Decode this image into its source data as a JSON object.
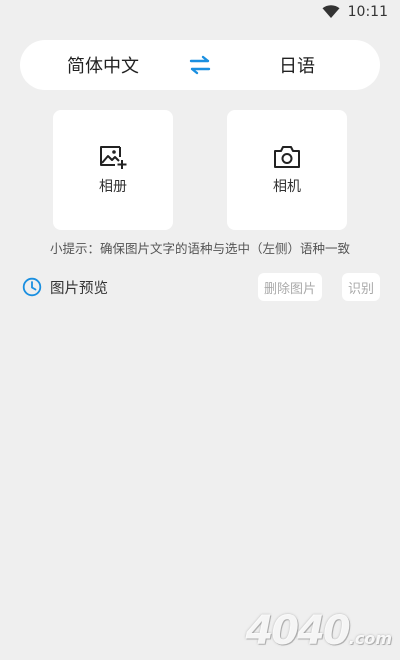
{
  "status_bar": {
    "time": "10:11",
    "wifi_icon": "wifi-icon"
  },
  "language_bar": {
    "source_language": "简体中文",
    "target_language": "日语",
    "swap_icon": "swap-arrows-icon",
    "swap_color": "#1a8fe0"
  },
  "actions": {
    "album": {
      "label": "相册",
      "icon": "image-add-icon"
    },
    "camera": {
      "label": "相机",
      "icon": "camera-icon"
    }
  },
  "tip": "小提示：确保图片文字的语种与选中（左侧）语种一致",
  "preview": {
    "title": "图片预览",
    "clock_icon": "clock-icon",
    "accent": "#1a8fe0",
    "delete_label": "删除图片",
    "recognize_label": "识别"
  },
  "watermark": {
    "text": "4040",
    "suffix": ".com"
  }
}
